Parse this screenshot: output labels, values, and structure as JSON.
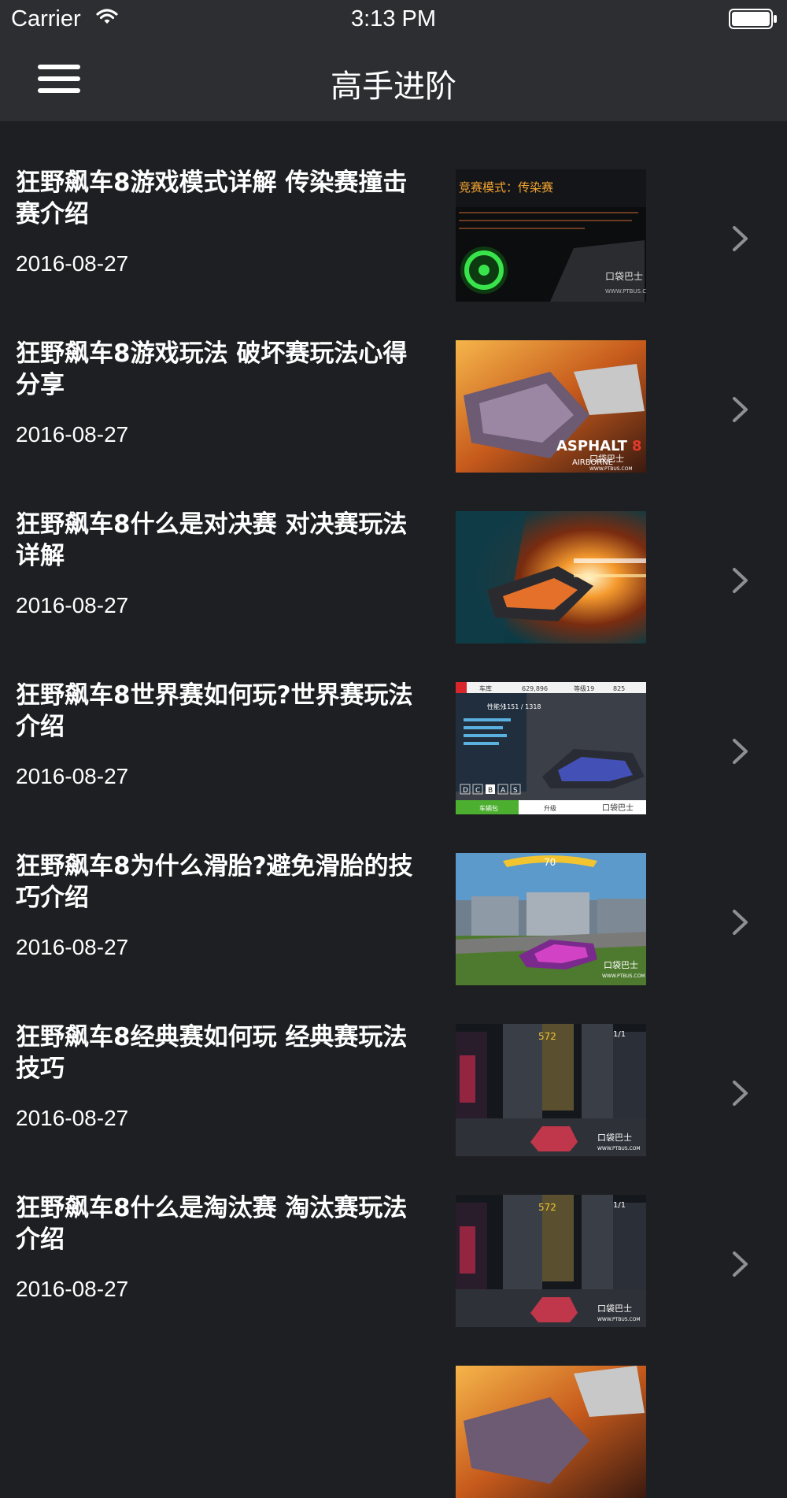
{
  "status_bar": {
    "carrier": "Carrier",
    "time": "3:13 PM",
    "wifi_icon": "wifi-icon",
    "battery_icon": "battery-icon"
  },
  "nav": {
    "title": "高手进阶",
    "menu_icon": "hamburger-menu-icon"
  },
  "articles": [
    {
      "title": "狂野飙车8游戏模式详解 传染赛撞击赛介绍",
      "date": "2016-08-27",
      "thumb_text": [
        "竞赛模式：传染赛",
        "口袋巴士",
        "WWW.PTBUS.COM"
      ]
    },
    {
      "title": "狂野飙车8游戏玩法 破坏赛玩法心得分享",
      "date": "2016-08-27",
      "thumb_text": [
        "ASPHALT",
        "AIRBORNE",
        "8",
        "口袋巴士",
        "WWW.PTBUS.COM"
      ]
    },
    {
      "title": "狂野飙车8什么是对决赛 对决赛玩法详解",
      "date": "2016-08-27",
      "thumb_text": []
    },
    {
      "title": "狂野飙车8世界赛如何玩?世界赛玩法介绍",
      "date": "2016-08-27",
      "thumb_text": [
        "车库",
        "629,896",
        "等级19",
        "825",
        "性能分",
        "1151 / 1318",
        "D",
        "C",
        "B",
        "A",
        "S",
        "车辆包",
        "升级",
        "口袋巴士"
      ]
    },
    {
      "title": "狂野飙车8为什么滑胎?避免滑胎的技巧介绍",
      "date": "2016-08-27",
      "thumb_text": [
        "70",
        "口袋巴士",
        "WWW.PTBUS.COM"
      ]
    },
    {
      "title": "狂野飙车8经典赛如何玩 经典赛玩法技巧",
      "date": "2016-08-27",
      "thumb_text": [
        "572",
        "1/1",
        "口袋巴士",
        "WWW.PTBUS.COM"
      ]
    },
    {
      "title": "狂野飙车8什么是淘汰赛 淘汰赛玩法介绍",
      "date": "2016-08-27",
      "thumb_text": [
        "572",
        "1/1",
        "口袋巴士",
        "WWW.PTBUS.COM"
      ]
    }
  ],
  "colors": {
    "background": "#1e1f22",
    "bar": "#2d2e31",
    "text": "#ffffff",
    "chevron": "#8e8e93"
  }
}
